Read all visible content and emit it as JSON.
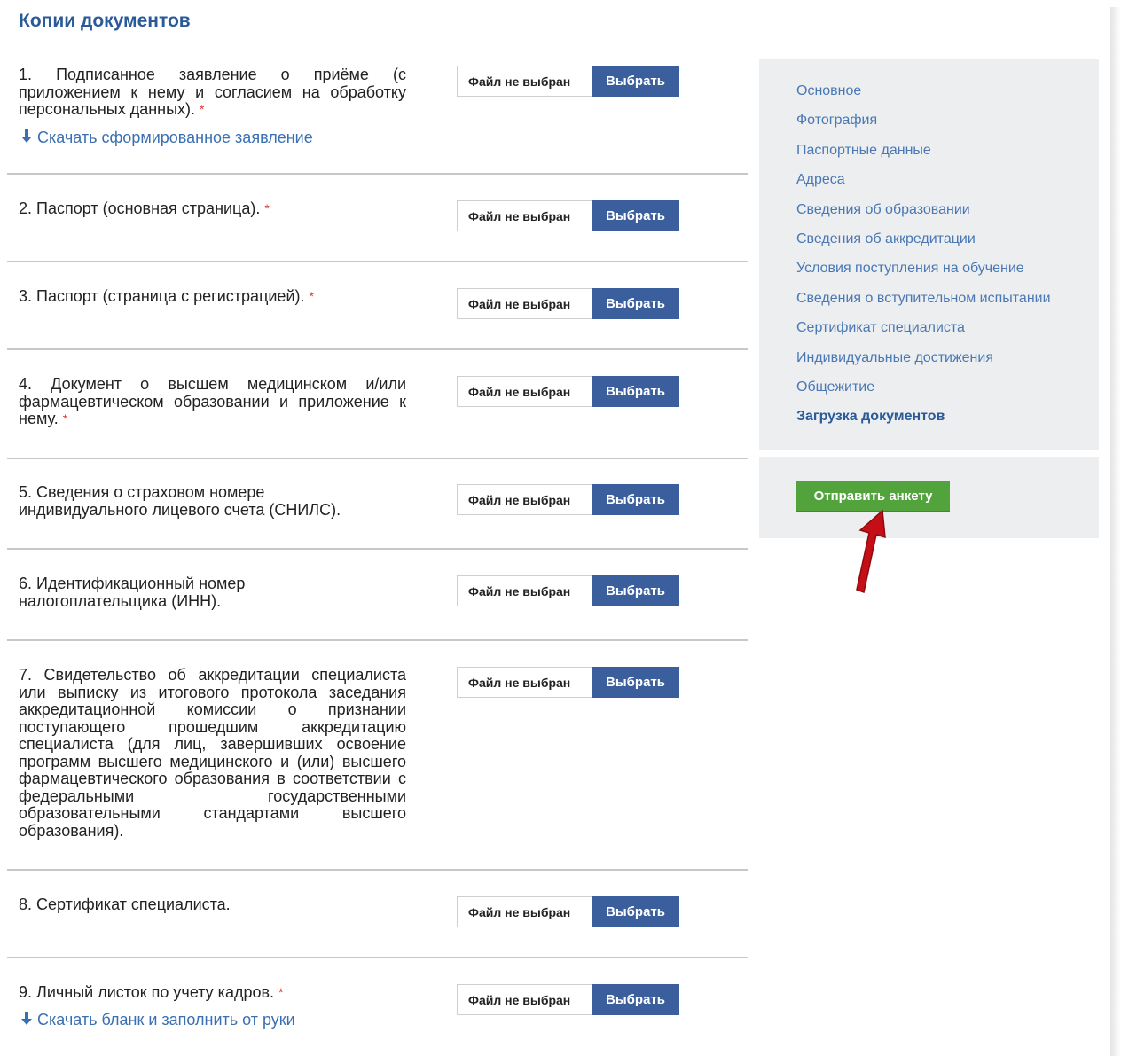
{
  "page": {
    "title": "Копии документов"
  },
  "file_input": {
    "status": "Файл не выбран",
    "button": "Выбрать"
  },
  "documents": [
    {
      "text": "1. Подписанное заявление о приёме (с приложением к нему и согласием на обработку персональных данных).",
      "required": "*",
      "link": "Скачать сформированное заявление"
    },
    {
      "text": "2. Паспорт (основная страница).",
      "required": "*"
    },
    {
      "text": "3. Паспорт (страница с регистрацией).",
      "required": "*"
    },
    {
      "text": "4. Документ о высшем медицинском и/или фармацевтическом образовании и приложение к нему.",
      "required": "*"
    },
    {
      "text": "5. Сведения о страховом номере индивидуального лицевого счета (СНИЛС)."
    },
    {
      "text": "6. Идентификационный номер налогоплательщика (ИНН)."
    },
    {
      "text": "7. Свидетельство об аккредитации специалиста или выписку из итогового протокола заседания аккредитационной комиссии о признании поступающего прошедшим аккредитацию специалиста (для лиц, завершивших освоение программ высшего медицинского и (или) высшего фармацевтического образования в соответствии с федеральными государственными образовательными стандартами высшего образования)."
    },
    {
      "text": "8. Сертификат специалиста."
    },
    {
      "text": "9. Личный листок по учету кадров.",
      "required": "*",
      "link": "Скачать бланк и заполнить от руки"
    }
  ],
  "sidebar": {
    "items": [
      {
        "label": "Основное"
      },
      {
        "label": "Фотография"
      },
      {
        "label": "Паспортные данные"
      },
      {
        "label": "Адреса"
      },
      {
        "label": "Сведения об образовании"
      },
      {
        "label": "Сведения об аккредитации"
      },
      {
        "label": "Условия поступления на обучение"
      },
      {
        "label": "Сведения о вступительном испытании"
      },
      {
        "label": "Сертификат специалиста"
      },
      {
        "label": "Индивидуальные достижения"
      },
      {
        "label": "Общежитие"
      },
      {
        "label": "Загрузка документов",
        "active": true
      }
    ],
    "submit_label": "Отправить анкету"
  },
  "colors": {
    "title": "#2a5a98",
    "link": "#3a6fb2",
    "file_button": "#3b5e9c",
    "submit_button": "#53a33d",
    "required_mark": "#d9383a",
    "annotation_arrow": "#c40f16",
    "sidebar_bg": "#eceeef"
  },
  "icons": {
    "download": "download-arrow-icon",
    "annotation": "red-pointer-arrow-icon"
  }
}
